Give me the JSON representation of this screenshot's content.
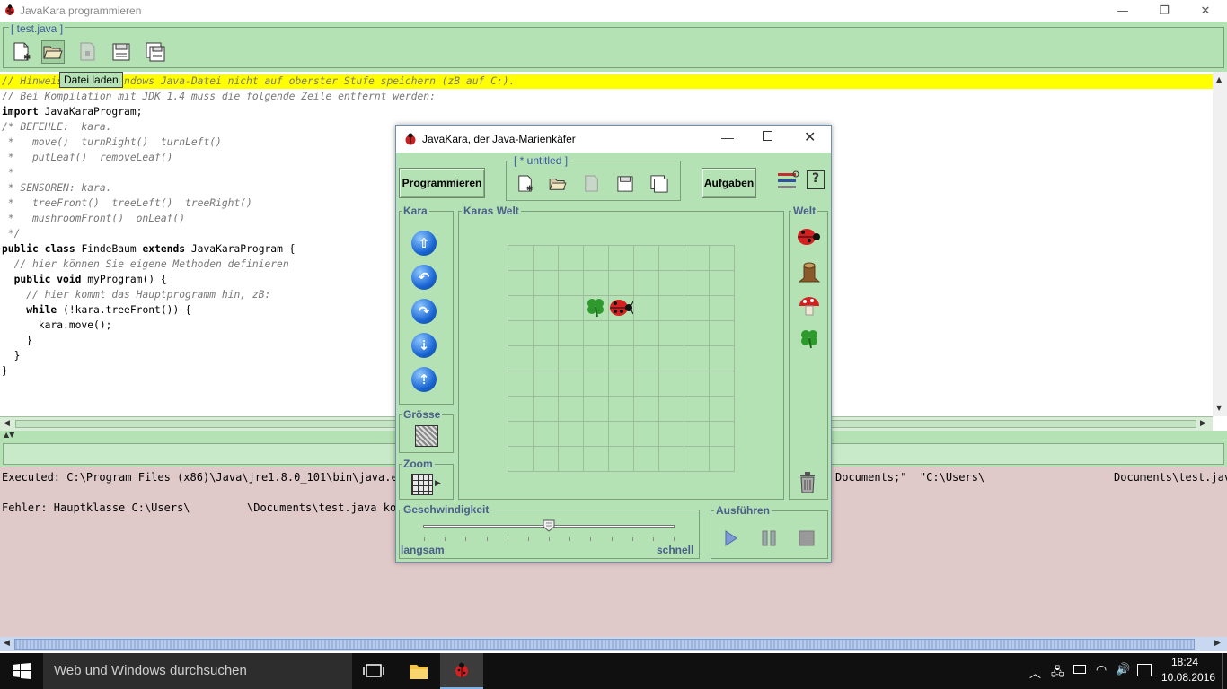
{
  "main_window": {
    "title": "JavaKara programmieren",
    "file_tab": "[ test.java ]",
    "tooltip": "Datei laden"
  },
  "editor": {
    "lines": [
      "// Hinweis: unter Windows Java-Datei nicht auf oberster Stufe speichern (zB auf C:).",
      "// Bei Kompilation mit JDK 1.4 muss die folgende Zeile entfernt werden:",
      "import JavaKaraProgram;",
      "/* BEFEHLE:  kara.",
      " *   move()  turnRight()  turnLeft()",
      " *   putLeaf()  removeLeaf()",
      " *",
      " * SENSOREN: kara.",
      " *   treeFront()  treeLeft()  treeRight()",
      " *   mushroomFront()  onLeaf()",
      " */",
      "public class FindeBaum extends JavaKaraProgram {",
      "  // hier können Sie eigene Methoden definieren",
      "  public void myProgram() {",
      "    // hier kommt das Hauptprogramm hin, zB:",
      "    while (!kara.treeFront()) {",
      "      kara.move();",
      "    }",
      "  }",
      "}"
    ]
  },
  "console": {
    "line1_left": "Executed: C:\\Program Files (x86)\\Java\\jre1.8.0_101\\bin\\java.exe",
    "line1_right": "Documents;\"  \"C:\\Users\\",
    "line1_tail": "Documents\\test.java",
    "line2_left": "Fehler: Hauptklasse C:\\Users\\",
    "line2_mid": "\\Documents\\test.java ko"
  },
  "kara_window": {
    "title": "JavaKara, der Java-Marienkäfer",
    "program_button": "Programmieren",
    "untitled_tab": "[ * untitled ]",
    "tasks_button": "Aufgaben",
    "group_kara": "Kara",
    "group_world": "Karas Welt",
    "group_welt": "Welt",
    "group_size": "Grösse",
    "group_zoom": "Zoom",
    "group_speed": "Geschwindigkeit",
    "speed_slow": "langsam",
    "speed_fast": "schnell",
    "group_run": "Ausführen",
    "speed_value": 0.5,
    "grid": {
      "columns": 9,
      "rows": 9,
      "leaf_cell": [
        3,
        2
      ],
      "kara_cell": [
        4,
        2
      ]
    }
  },
  "taskbar": {
    "search_placeholder": "Web und Windows durchsuchen",
    "time": "18:24",
    "date": "10.08.2016"
  }
}
